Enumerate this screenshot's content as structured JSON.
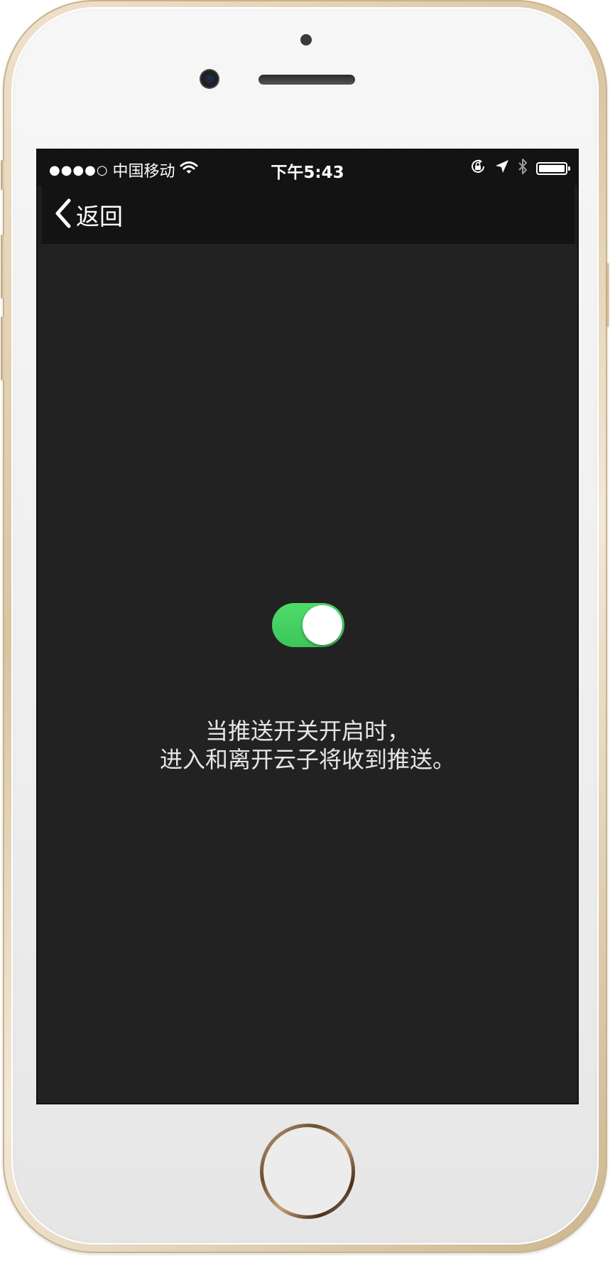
{
  "statusbar": {
    "signal_dots": "●●●●○",
    "carrier": "中国移动",
    "time": "下午5:43"
  },
  "navbar": {
    "back_label": "返回"
  },
  "push_toggle": {
    "state": "on",
    "on_color": "#4cd964"
  },
  "message": {
    "line1": "当推送开关开启时，",
    "line2": "进入和离开云子将收到推送。"
  }
}
